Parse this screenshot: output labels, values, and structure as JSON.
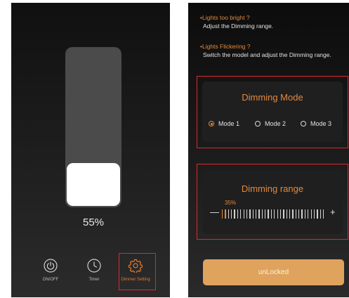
{
  "left_screen": {
    "brightness": {
      "percent_label": "55%"
    },
    "nav": {
      "onoff_label": "ON/OFF",
      "timer_label": "Timer",
      "dimmer_label": "Dimmer Setting"
    }
  },
  "right_screen": {
    "tips": [
      {
        "question": "Lights too bright ?",
        "answer": "Adjust the Dimming range."
      },
      {
        "question": "Lights Flickering ?",
        "answer": "Switch the model and adjust the Dimming range."
      }
    ],
    "dimming_mode": {
      "title": "Dimming Mode",
      "options": [
        "Mode 1",
        "Mode 2",
        "Mode 3"
      ],
      "selected_index": 0
    },
    "dimming_range": {
      "title": "Dimming range",
      "percent_label": "35%",
      "value_percent": 35,
      "minus_label": "—",
      "plus_label": "+"
    },
    "unlock_label": "unLocked"
  },
  "colors": {
    "accent": "#e38a3e",
    "button": "#dfa35e",
    "highlight_outline": "#e0262b"
  },
  "icons": [
    "power-icon",
    "clock-icon",
    "gear-icon"
  ]
}
